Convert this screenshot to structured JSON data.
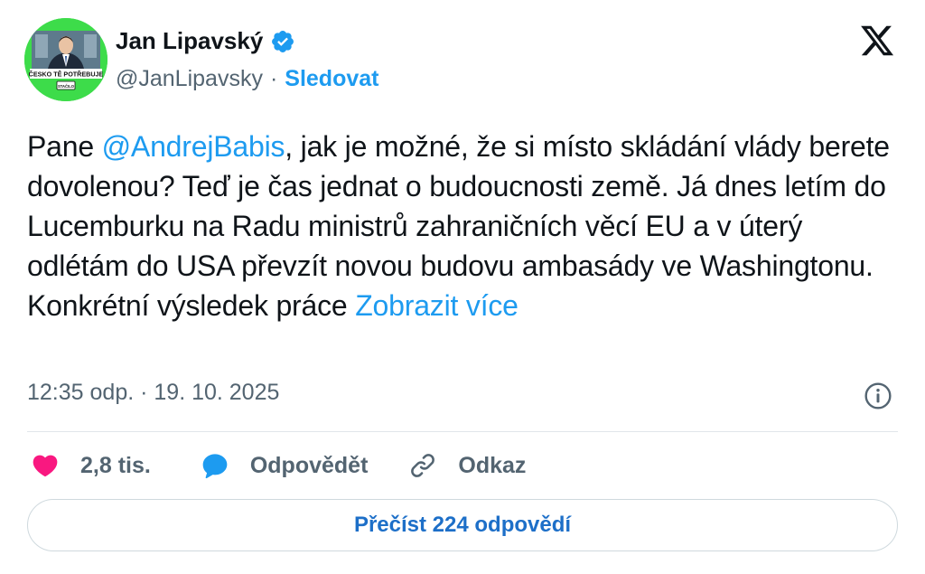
{
  "author": {
    "name": "Jan Lipavský",
    "handle": "@JanLipavsky",
    "separator": "·",
    "follow_label": "Sledovat",
    "avatar_caption": "ČESKO TĚ POTŘEBUJE",
    "avatar_badge": "STAČILO"
  },
  "tweet": {
    "text_intro": "Pane ",
    "mention": "@AndrejBabis",
    "text_body": ", jak je možné, že si místo skládání vlády berete dovolenou? Teď je čas jednat o budoucnosti země. Já dnes letím do Lucemburku na Radu ministrů zahraničních věcí EU a v úterý odlétám do USA převzít novou budovu ambasády ve Washingtonu. Konkrétní výsledek práce ",
    "show_more": "Zobrazit více"
  },
  "meta": {
    "timestamp": "12:35 odp. · 19. 10. 2025"
  },
  "actions": {
    "likes": "2,8 tis.",
    "reply_label": "Odpovědět",
    "link_label": "Odkaz"
  },
  "read_replies": "Přečíst 224 odpovědí",
  "icons": {
    "platform_logo": "x-logo-icon",
    "verified": "verified-badge-icon",
    "info": "info-icon",
    "like": "heart-icon",
    "reply": "speech-bubble-icon",
    "link": "link-icon"
  },
  "colors": {
    "accent": "#1d9bf0",
    "heart": "#f91880",
    "secondary_text": "#536471",
    "avatar_background": "#3ddc4a"
  }
}
